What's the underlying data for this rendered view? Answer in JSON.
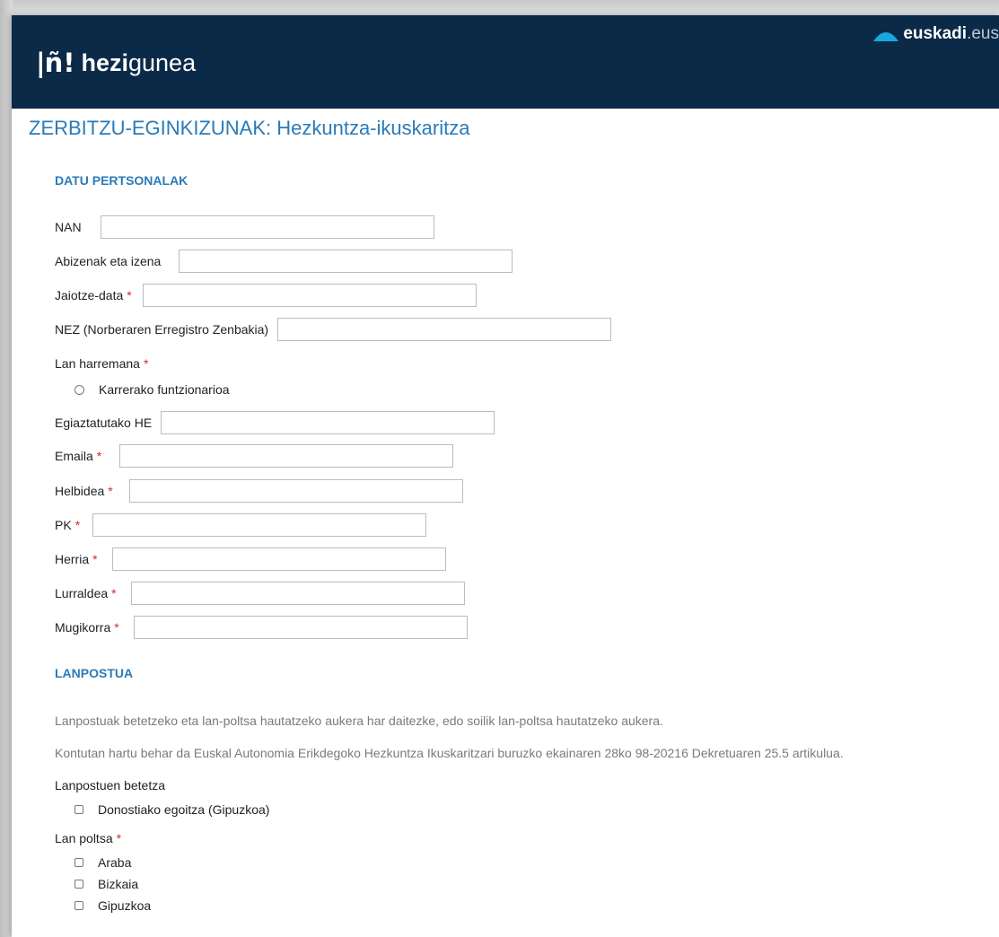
{
  "header": {
    "logo_mark_left": "|ñ",
    "logo_mark_bang": "!",
    "logo_bold": "hezi",
    "logo_rest": "gunea",
    "brand_bold": "euskadi",
    "brand_rest": ".eus",
    "background": "#0b2a48"
  },
  "page_title": "ZERBITZU-EGINKIZUNAK: Hezkuntza-ikuskaritza",
  "accent_color": "#2a7bb8",
  "required_color": "#d62a2a",
  "personal": {
    "title": "DATU PERTSONALAK",
    "nan": {
      "label": "NAN",
      "value": ""
    },
    "abizenak": {
      "label": "Abizenak eta izena",
      "value": ""
    },
    "jaiotze": {
      "label": "Jaiotze-data",
      "required": "*",
      "value": ""
    },
    "nez": {
      "label": "NEZ (Norberaren Erregistro Zenbakia)",
      "value": ""
    },
    "lan_harremana": {
      "label": "Lan harremana",
      "required": "*",
      "option": "Karrerako funtzionarioa"
    },
    "he": {
      "label": "Egiaztatutako HE",
      "value": ""
    },
    "emaila": {
      "label": "Emaila",
      "required": "*",
      "value": ""
    },
    "helbidea": {
      "label": "Helbidea",
      "required": "*",
      "value": ""
    },
    "pk": {
      "label": "PK",
      "required": "*",
      "value": ""
    },
    "herria": {
      "label": "Herria",
      "required": "*",
      "value": ""
    },
    "lurraldea": {
      "label": "Lurraldea",
      "required": "*",
      "value": ""
    },
    "mugikorra": {
      "label": "Mugikorra",
      "required": "*",
      "value": ""
    }
  },
  "lanpostua": {
    "title": "LANPOSTUA",
    "note1": "Lanpostuak betetzeko eta lan-poltsa hautatzeko aukera har daitezke, edo soilik lan-poltsa hautatzeko aukera.",
    "note2": "Kontutan hartu behar da Euskal Autonomia Erikdegoko Hezkuntza Ikuskaritzari buruzko ekainaren 28ko 98-20216 Dekretuaren 25.5 artikulua.",
    "betetza_label": "Lanpostuen betetza",
    "betetza_option": "Donostiako egoitza (Gipuzkoa)",
    "poltsa_label": "Lan poltsa",
    "poltsa_required": "*",
    "poltsa_options": [
      "Araba",
      "Bizkaia",
      "Gipuzkoa"
    ]
  }
}
